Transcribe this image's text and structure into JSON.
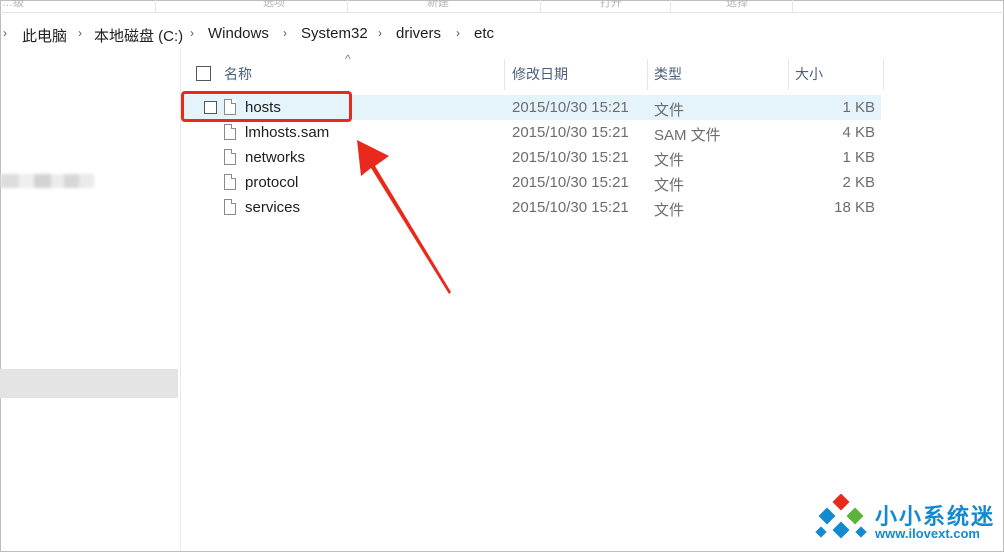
{
  "ribbon": {
    "labels": [
      "…级",
      "选项",
      "新建",
      "打开",
      "选择"
    ]
  },
  "breadcrumb": {
    "items": [
      "此电脑",
      "本地磁盘 (C:)",
      "Windows",
      "System32",
      "drivers",
      "etc"
    ]
  },
  "columns": {
    "name": "名称",
    "date": "修改日期",
    "type": "类型",
    "size": "大小"
  },
  "files": [
    {
      "name": "hosts",
      "date": "2015/10/30 15:21",
      "type": "文件",
      "size": "1 KB",
      "selected": true
    },
    {
      "name": "lmhosts.sam",
      "date": "2015/10/30 15:21",
      "type": "SAM 文件",
      "size": "4 KB"
    },
    {
      "name": "networks",
      "date": "2015/10/30 15:21",
      "type": "文件",
      "size": "1 KB"
    },
    {
      "name": "protocol",
      "date": "2015/10/30 15:21",
      "type": "文件",
      "size": "2 KB"
    },
    {
      "name": "services",
      "date": "2015/10/30 15:21",
      "type": "文件",
      "size": "18 KB"
    }
  ],
  "annotation": {
    "color": "#e8291c"
  },
  "watermark": {
    "title": "小小系统迷",
    "url": "www.ilovext.com",
    "color": "#1389d0"
  },
  "colors": {
    "selected_row": "#e5f3fb",
    "header_text": "#4c607a"
  }
}
